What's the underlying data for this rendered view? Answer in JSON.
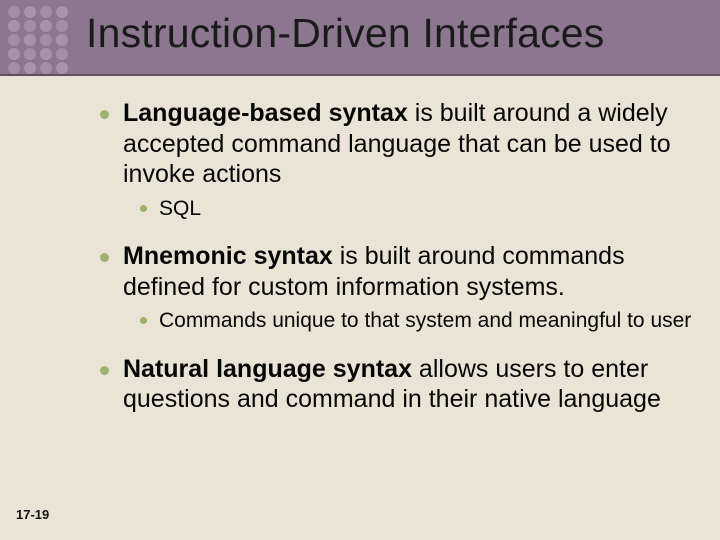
{
  "title": "Instruction-Driven Interfaces",
  "bullets": {
    "b1": {
      "bold": "Language-based syntax",
      "rest": " is built around a widely accepted command language that can be used to invoke actions",
      "sub": "SQL"
    },
    "b2": {
      "bold": "Mnemonic syntax",
      "rest": " is built around commands defined for custom information systems.",
      "sub": "Commands unique to that system and meaningful to user"
    },
    "b3": {
      "bold": "Natural language syntax",
      "rest": " allows users to enter questions and command in their native language"
    }
  },
  "slide_number": "17-19"
}
